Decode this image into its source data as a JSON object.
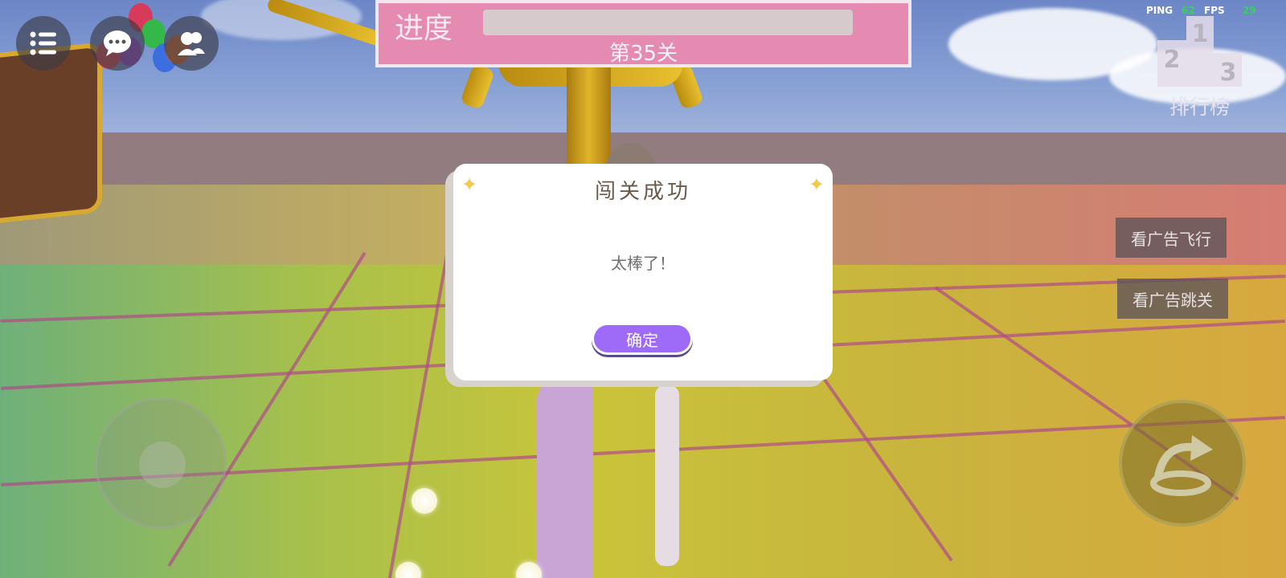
{
  "hud": {
    "progress_label": "进度",
    "progress_value": 0,
    "level_text": "第35关",
    "ping_label": "PING",
    "ping_value": "62",
    "fps_label": "FPS",
    "fps_value": "29",
    "leaderboard_label": "排行榜",
    "ad_fly_label": "看广告飞行",
    "ad_skip_label": "看广告跳关"
  },
  "dialog": {
    "title": "闯关成功",
    "message": "太棒了！",
    "confirm_label": "确定"
  },
  "colors": {
    "progress_panel": "#e58ab1",
    "confirm_button": "#9d6bf7",
    "ping_value": "#35d35a"
  },
  "icons": [
    "menu-icon",
    "chat-icon",
    "friends-icon",
    "leaderboard-podium-icon",
    "jump-icon",
    "sparkle-icon"
  ]
}
